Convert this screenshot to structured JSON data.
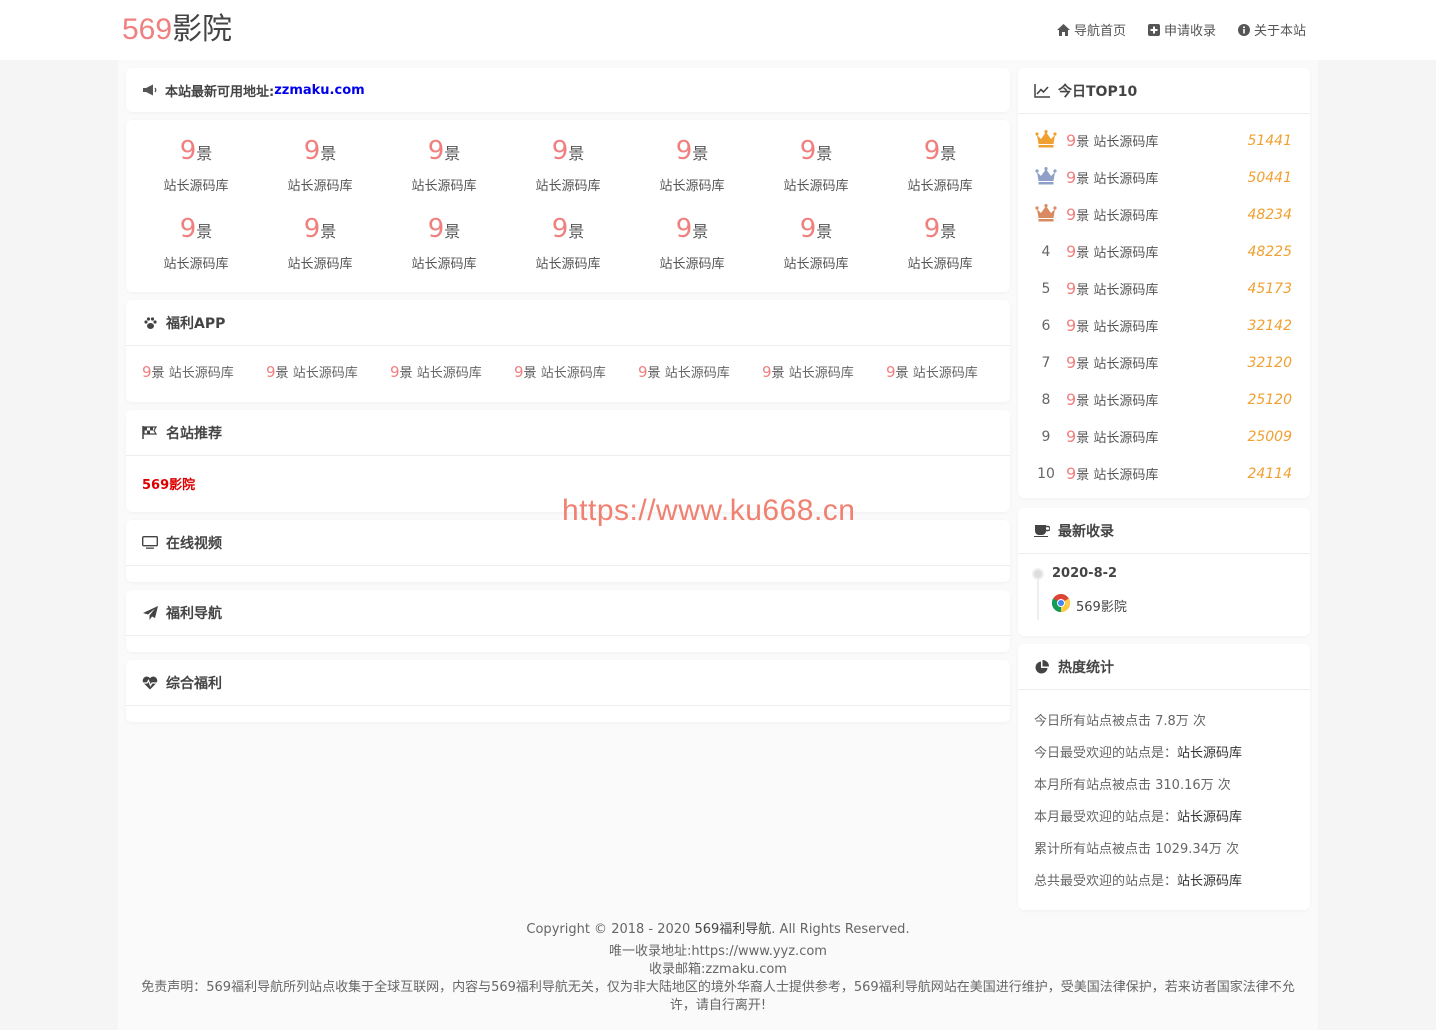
{
  "header": {
    "logo_num": "569",
    "logo_text": "影院",
    "nav": [
      {
        "label": "导航首页",
        "icon": "home-icon"
      },
      {
        "label": "申请收录",
        "icon": "plus-square-icon"
      },
      {
        "label": "关于本站",
        "icon": "info-circle-icon"
      }
    ]
  },
  "notice": {
    "label": "本站最新可用地址:",
    "url": "zzmaku.com"
  },
  "grid": {
    "logo_a": "9",
    "logo_b": "景",
    "items": [
      "站长源码库",
      "站长源码库",
      "站长源码库",
      "站长源码库",
      "站长源码库",
      "站长源码库",
      "站长源码库",
      "站长源码库",
      "站长源码库",
      "站长源码库",
      "站长源码库",
      "站长源码库",
      "站长源码库",
      "站长源码库"
    ]
  },
  "apps": {
    "title": "福利APP",
    "logo_a": "9",
    "logo_b": "景",
    "items": [
      "站长源码库",
      "站长源码库",
      "站长源码库",
      "站长源码库",
      "站长源码库",
      "站长源码库",
      "站长源码库"
    ]
  },
  "recommend": {
    "title": "名站推荐",
    "link": "569影院"
  },
  "video": {
    "title": "在线视频"
  },
  "fnav": {
    "title": "福利导航"
  },
  "zh": {
    "title": "综合福利"
  },
  "top10": {
    "title": "今日TOP10",
    "logo_a": "9",
    "logo_b": "景",
    "rows": [
      {
        "rank": "",
        "name": "站长源码库",
        "count": "51441",
        "crown": "#f0a030"
      },
      {
        "rank": "",
        "name": "站长源码库",
        "count": "50441",
        "crown": "#8fa0c8"
      },
      {
        "rank": "",
        "name": "站长源码库",
        "count": "48234",
        "crown": "#d98a60"
      },
      {
        "rank": "4",
        "name": "站长源码库",
        "count": "48225"
      },
      {
        "rank": "5",
        "name": "站长源码库",
        "count": "45173"
      },
      {
        "rank": "6",
        "name": "站长源码库",
        "count": "32142"
      },
      {
        "rank": "7",
        "name": "站长源码库",
        "count": "32120"
      },
      {
        "rank": "8",
        "name": "站长源码库",
        "count": "25120"
      },
      {
        "rank": "9",
        "name": "站长源码库",
        "count": "25009"
      },
      {
        "rank": "10",
        "name": "站长源码库",
        "count": "24114"
      }
    ]
  },
  "latest": {
    "title": "最新收录",
    "date": "2020-8-2",
    "site": "569影院"
  },
  "stats": {
    "title": "热度统计",
    "lines": [
      {
        "label": "今日所有站点被点击 7.8万 次",
        "value": ""
      },
      {
        "label": "今日最受欢迎的站点是：",
        "value": "站长源码库"
      },
      {
        "label": "本月所有站点被点击 310.16万 次",
        "value": ""
      },
      {
        "label": "本月最受欢迎的站点是：",
        "value": "站长源码库"
      },
      {
        "label": "累计所有站点被点击 1029.34万 次",
        "value": ""
      },
      {
        "label": "总共最受欢迎的站点是：",
        "value": "站长源码库"
      }
    ]
  },
  "watermark": "https://www.ku668.cn",
  "footer": {
    "copyright_a": "Copyright © 2018 - 2020 ",
    "copyright_site": "569福利导航",
    "copyright_b": ". All Rights Reserved.",
    "address": "唯一收录地址:https://www.yyz.com",
    "email": "收录邮箱:zzmaku.com",
    "disclaimer": "免责声明：569福利导航所列站点收集于全球互联网，内容与569福利导航无关，仅为非大陆地区的境外华裔人士提供参考，569福利导航网站在美国进行维护，受美国法律保护，若来访者国家法律不允许，请自行离开!"
  },
  "colors": {
    "accent": "#f08080",
    "count": "#f0a030",
    "link_red": "#dd0000",
    "link_blue": "#0000ee"
  }
}
